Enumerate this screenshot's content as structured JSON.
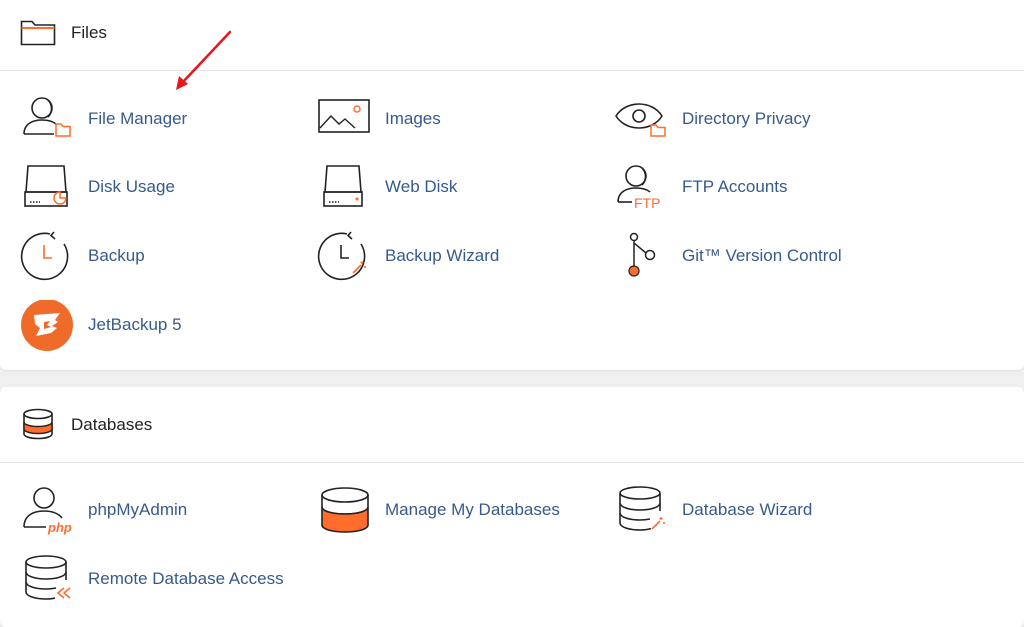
{
  "colors": {
    "accent": "#ff6c2c",
    "link": "#375a8c",
    "icon_stroke": "#222222",
    "arrow": "#e8151b"
  },
  "files": {
    "title": "Files",
    "icon": "folder-icon",
    "items": [
      {
        "label": "File Manager",
        "icon": "file-manager-icon"
      },
      {
        "label": "Images",
        "icon": "images-icon"
      },
      {
        "label": "Directory Privacy",
        "icon": "directory-privacy-icon"
      },
      {
        "label": "Disk Usage",
        "icon": "disk-usage-icon"
      },
      {
        "label": "Web Disk",
        "icon": "web-disk-icon"
      },
      {
        "label": "FTP Accounts",
        "icon": "ftp-accounts-icon"
      },
      {
        "label": "Backup",
        "icon": "backup-icon"
      },
      {
        "label": "Backup Wizard",
        "icon": "backup-wizard-icon"
      },
      {
        "label": "Git™ Version Control",
        "icon": "git-version-control-icon"
      },
      {
        "label": "JetBackup 5",
        "icon": "jetbackup-icon"
      }
    ],
    "ftp_icon_text": "FTP",
    "php_icon_text": "php"
  },
  "databases": {
    "title": "Databases",
    "icon": "database-icon",
    "items": [
      {
        "label": "phpMyAdmin",
        "icon": "phpmyadmin-icon"
      },
      {
        "label": "Manage My Databases",
        "icon": "manage-databases-icon"
      },
      {
        "label": "Database Wizard",
        "icon": "database-wizard-icon"
      },
      {
        "label": "Remote Database Access",
        "icon": "remote-database-access-icon"
      }
    ]
  }
}
